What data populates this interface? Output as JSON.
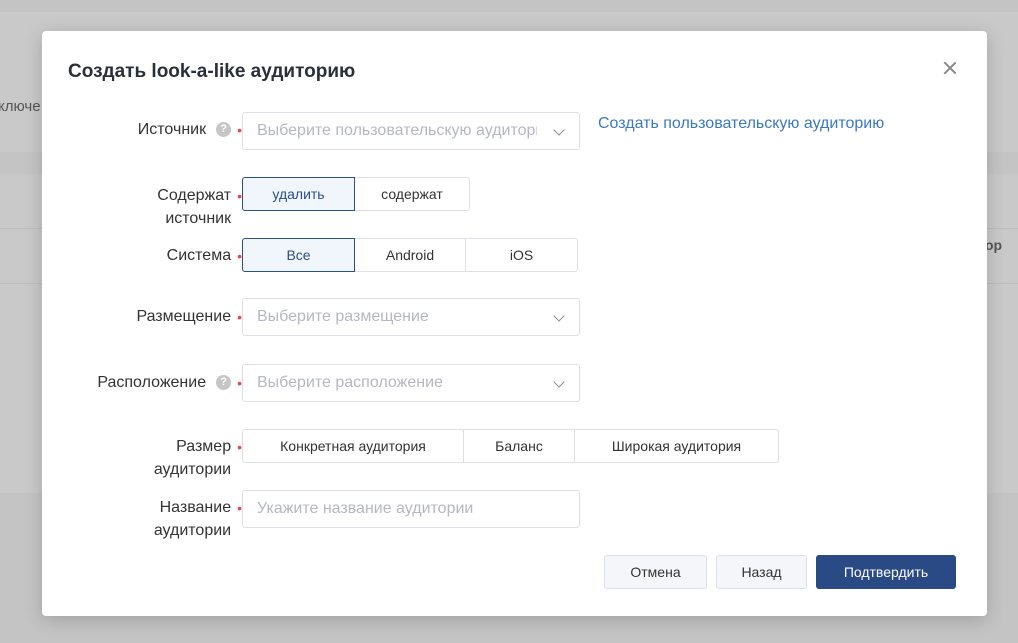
{
  "background": {
    "fragment_left": "ключе",
    "fragment_right": "ор"
  },
  "modal": {
    "title": "Создать look-a-like аудиторию",
    "link_create_audience": "Создать пользовательскую аудиторию",
    "fields": {
      "source": {
        "label": "Источник",
        "placeholder": "Выберите пользовательскую аудиторию"
      },
      "contains_source": {
        "label": "Содержат\nисточник",
        "options": [
          "удалить",
          "содержат"
        ],
        "selected": "удалить"
      },
      "system": {
        "label": "Система",
        "options": [
          "Все",
          "Android",
          "iOS"
        ],
        "selected": "Все"
      },
      "placement": {
        "label": "Размещение",
        "placeholder": "Выберите размещение"
      },
      "location": {
        "label": "Расположение",
        "placeholder": "Выберите расположение"
      },
      "audience_size": {
        "label": "Размер\nаудитории",
        "options": [
          "Конкретная аудитория",
          "Баланс",
          "Широкая аудитория"
        ],
        "selected": ""
      },
      "audience_name": {
        "label": "Название\nаудитории",
        "placeholder": "Укажите название аудитории",
        "value": ""
      }
    },
    "required_mark": "•",
    "help_mark": "?",
    "buttons": {
      "cancel": "Отмена",
      "back": "Назад",
      "confirm": "Подтвердить"
    }
  },
  "colors": {
    "accent": "#2a4a85",
    "link": "#3b78c2",
    "required": "#e04b4b"
  }
}
